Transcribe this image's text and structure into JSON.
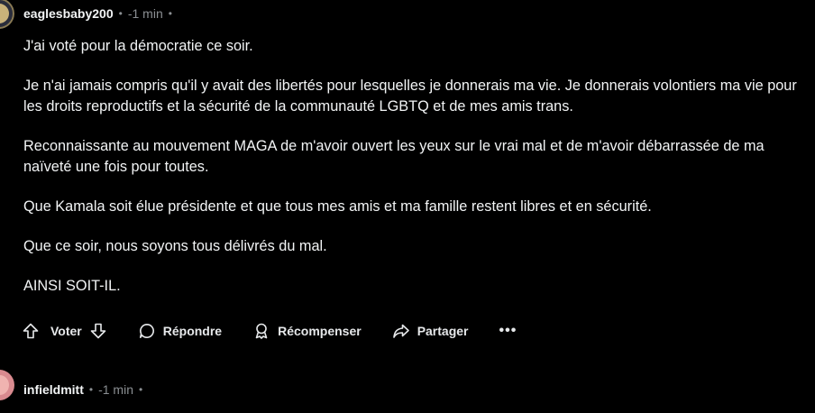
{
  "comments": [
    {
      "author": "eaglesbaby200",
      "separator": "•",
      "time": "-1 min",
      "paragraphs": [
        "J'ai voté pour la démocratie ce soir.",
        "Je n'ai jamais compris qu'il y avait des libertés pour lesquelles je donnerais ma vie. Je donnerais volontiers ma vie pour les droits reproductifs et la sécurité de la communauté LGBTQ et de mes amis trans.",
        "Reconnaissante au mouvement MAGA de m'avoir ouvert les yeux sur le vrai mal et de m'avoir débarrassée de ma naïveté une fois pour toutes.",
        "Que Kamala soit élue présidente et que tous mes amis et ma famille restent libres et en sécurité.",
        "Que ce soir, nous soyons tous délivrés du mal.",
        "AINSI SOIT-IL."
      ],
      "actions": {
        "vote": "Voter",
        "reply": "Répondre",
        "award": "Récompenser",
        "share": "Partager",
        "more": "•••"
      }
    },
    {
      "author": "infieldmitt",
      "separator": "•",
      "time": "-1 min"
    }
  ],
  "icons": {
    "upvote": "upvote-icon",
    "downvote": "downvote-icon",
    "reply": "comment-bubble-icon",
    "award": "award-icon",
    "share": "share-arrow-icon",
    "more": "more-dots-icon"
  },
  "colors": {
    "background": "#000000",
    "text": "#f2f4f5",
    "meta": "#8b8f93"
  }
}
